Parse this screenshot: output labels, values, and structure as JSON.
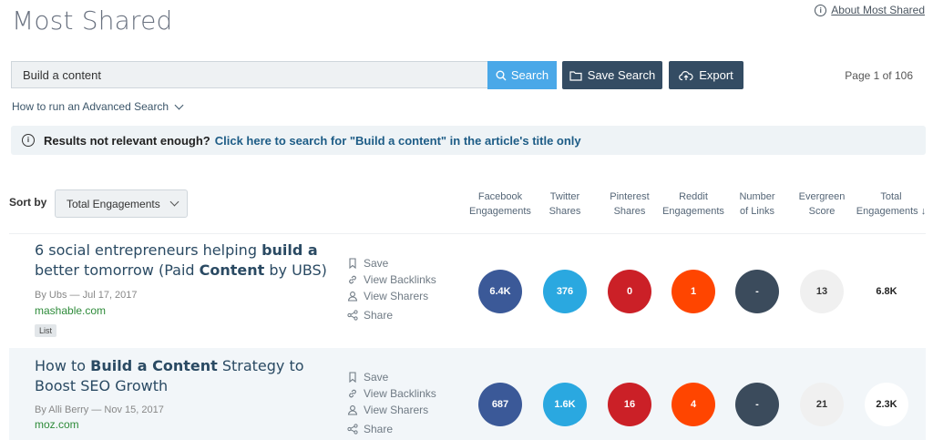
{
  "header": {
    "title": "Most Shared",
    "about_link": "About Most Shared"
  },
  "search": {
    "value": "Build a content",
    "button": "Search",
    "save_search": "Save Search",
    "export": "Export",
    "page_info": "Page 1 of 106",
    "advanced": "How to run an Advanced Search"
  },
  "banner": {
    "prefix": "Results not relevant enough?",
    "link": "Click here to search for \"Build a content\" in the article's title only"
  },
  "sort": {
    "label": "Sort by",
    "selected": "Total Engagements"
  },
  "columns": {
    "facebook": [
      "Facebook",
      "Engagements"
    ],
    "twitter": [
      "Twitter",
      "Shares"
    ],
    "pinterest": [
      "Pinterest",
      "Shares"
    ],
    "reddit": [
      "Reddit",
      "Engagements"
    ],
    "links": [
      "Number",
      "of Links"
    ],
    "evergreen": [
      "Evergreen",
      "Score"
    ],
    "total": [
      "Total",
      "Engagements ↓"
    ]
  },
  "actions": {
    "save": "Save",
    "backlinks": "View Backlinks",
    "sharers": "View Sharers",
    "share": "Share"
  },
  "results": [
    {
      "title_parts": [
        "6 social entrepreneurs helping ",
        "build a",
        " better tomorrow (Paid ",
        "Content",
        " by UBS)"
      ],
      "author": "By Ubs",
      "date": "Jul 17, 2017",
      "domain": "mashable.com",
      "tag": "List",
      "facebook": "6.4K",
      "twitter": "376",
      "pinterest": "0",
      "reddit": "1",
      "links": "-",
      "evergreen": "13",
      "total": "6.8K"
    },
    {
      "title_parts": [
        "How to ",
        "Build a Content",
        " Strategy to Boost SEO Growth"
      ],
      "author": "By Alli Berry",
      "date": "Nov 15, 2017",
      "domain": "moz.com",
      "facebook": "687",
      "twitter": "1.6K",
      "pinterest": "16",
      "reddit": "4",
      "links": "-",
      "evergreen": "21",
      "total": "2.3K"
    }
  ],
  "colors": {
    "facebook": "#3b5998",
    "twitter": "#2aa8e0",
    "pinterest": "#cb2027",
    "reddit": "#ff4500",
    "links": "#3b4b5c",
    "search_button": "#4aa8e8",
    "dark_button": "#344c63"
  }
}
